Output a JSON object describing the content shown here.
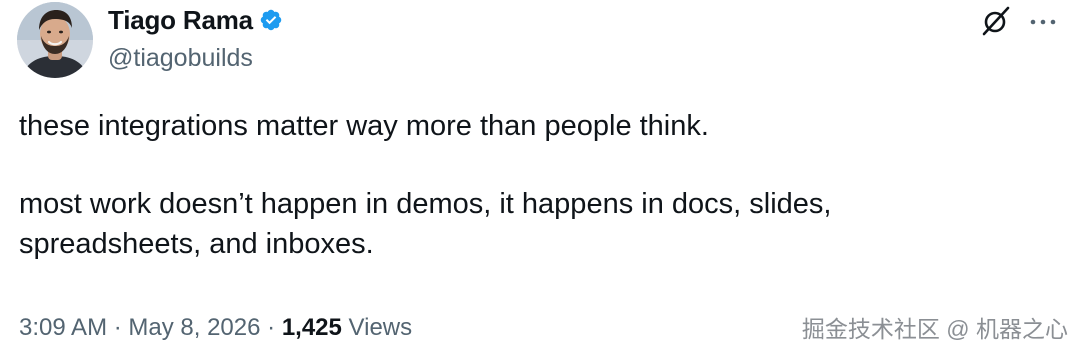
{
  "author": {
    "display_name": "Tiago Rama",
    "handle": "@tiagobuilds",
    "verified": true,
    "verified_color": "#1d9bf0"
  },
  "actions": {
    "grok_icon": "grok-slash-circle-icon",
    "more_icon": "more-horizontal-icon"
  },
  "tweet": {
    "paragraphs": [
      "these integrations matter way more than people think.",
      "most work doesn’t happen in demos, it happens in docs, slides,\nspreadsheets, and inboxes."
    ]
  },
  "meta": {
    "time": "3:09 AM",
    "separator_1": " · ",
    "date": "May 8, 2026",
    "separator_2": " · ",
    "views_count": "1,425",
    "views_label": " Views"
  },
  "watermark": "掘金技术社区 @ 机器之心",
  "colors": {
    "text_primary": "#0f1419",
    "text_secondary": "#536471",
    "accent": "#1d9bf0"
  }
}
